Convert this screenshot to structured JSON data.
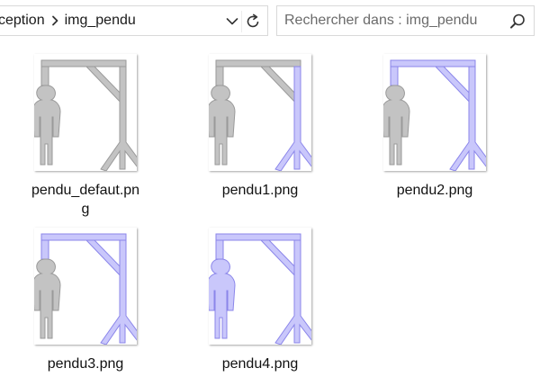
{
  "address_bar": {
    "breadcrumbs": [
      "ception",
      "img_pendu"
    ],
    "search_placeholder": "Rechercher dans : img_pendu"
  },
  "colors": {
    "gray_fill": "#c3c3c3",
    "gray_stroke": "#9a9a9a",
    "violet_fill": "#c9c7fb",
    "violet_stroke": "#8b86ea"
  },
  "files": [
    {
      "name": "pendu_defaut.png",
      "name_line1": "pendu_defaut.pn",
      "name_line2": "g",
      "highlight": {
        "right_post": false,
        "top_beam": false,
        "person": false
      }
    },
    {
      "name": "pendu1.png",
      "highlight": {
        "right_post": true,
        "top_beam": false,
        "person": false
      }
    },
    {
      "name": "pendu2.png",
      "highlight": {
        "right_post": true,
        "top_beam": true,
        "person": false
      }
    },
    {
      "name": "pendu3.png",
      "highlight": {
        "right_post": true,
        "top_beam": true,
        "person": false
      }
    },
    {
      "name": "pendu4.png",
      "highlight": {
        "right_post": true,
        "top_beam": true,
        "person": true
      }
    }
  ]
}
